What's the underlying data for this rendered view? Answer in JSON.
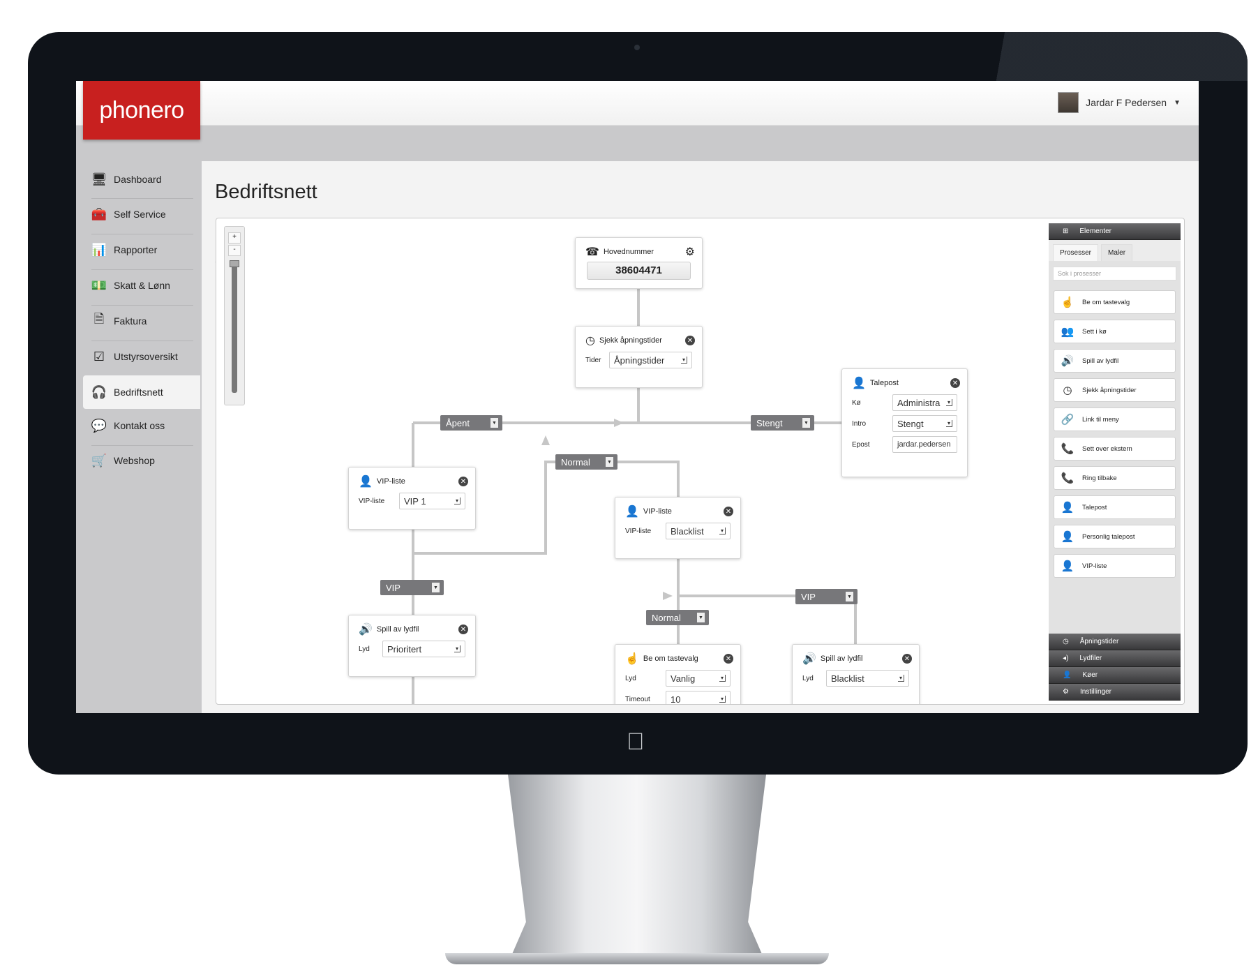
{
  "app": {
    "logo": "phonero",
    "user_name": "Jardar F Pedersen",
    "brand_color": "#c8201f"
  },
  "sidebar": {
    "items": [
      {
        "label": "Dashboard",
        "icon": "monitor-icon"
      },
      {
        "label": "Self Service",
        "icon": "toolbox-icon"
      },
      {
        "label": "Rapporter",
        "icon": "report-icon"
      },
      {
        "label": "Skatt & Lønn",
        "icon": "money-icon"
      },
      {
        "label": "Faktura",
        "icon": "document-icon"
      },
      {
        "label": "Utstyrsoversikt",
        "icon": "checklist-icon"
      },
      {
        "label": "Bedriftsnett",
        "icon": "headset-icon",
        "active": true
      },
      {
        "label": "Kontakt oss",
        "icon": "chat-icon"
      },
      {
        "label": "Webshop",
        "icon": "cart-icon"
      }
    ]
  },
  "page": {
    "title": "Bedriftsnett"
  },
  "zoom": {
    "plus": "+",
    "minus": "-"
  },
  "flow": {
    "hoved": {
      "title": "Hovednummer",
      "number": "38604471"
    },
    "sjekk": {
      "title": "Sjekk åpningstider",
      "label": "Tider",
      "value": "Åpningstider"
    },
    "talepost": {
      "title": "Talepost",
      "ko_label": "Kø",
      "ko": "Administra",
      "intro_label": "Intro",
      "intro": "Stengt",
      "epost_label": "Epost",
      "epost": "jardar.pedersen"
    },
    "tags": {
      "apent": "Åpent",
      "stengt": "Stengt",
      "normal1": "Normal",
      "vip1": "VIP",
      "normal2": "Normal",
      "vip2": "VIP"
    },
    "vip1": {
      "title": "VIP-liste",
      "label": "VIP-liste",
      "value": "VIP 1"
    },
    "vip2": {
      "title": "VIP-liste",
      "label": "VIP-liste",
      "value": "Blacklist"
    },
    "spill1": {
      "title": "Spill av lydfil",
      "label": "Lyd",
      "value": "Prioritert"
    },
    "tastevalg": {
      "title": "Be om tastevalg",
      "label": "Lyd",
      "value": "Vanlig",
      "label2": "Timeout",
      "value2": "10"
    },
    "spill2": {
      "title": "Spill av lydfil",
      "label": "Lyd",
      "value": "Blacklist"
    }
  },
  "panel": {
    "header": "Elementer",
    "tabs": [
      "Prosesser",
      "Maler"
    ],
    "search_placeholder": "Sok i prosesser",
    "items": [
      {
        "label": "Be om tastevalg",
        "icon": "keypad-icon"
      },
      {
        "label": "Sett i kø",
        "icon": "queue-icon"
      },
      {
        "label": "Spill av lydfil",
        "icon": "speaker-icon"
      },
      {
        "label": "Sjekk åpningstider",
        "icon": "clock-icon"
      },
      {
        "label": "Link til meny",
        "icon": "link-icon"
      },
      {
        "label": "Sett over ekstern",
        "icon": "transfer-icon"
      },
      {
        "label": "Ring tilbake",
        "icon": "callback-icon"
      },
      {
        "label": "Talepost",
        "icon": "user-icon"
      },
      {
        "label": "Personlig talepost",
        "icon": "user-icon"
      },
      {
        "label": "VIP-liste",
        "icon": "user-icon"
      }
    ],
    "footer": [
      {
        "label": "Åpningstider",
        "icon": "clock-icon"
      },
      {
        "label": "Lydfiler",
        "icon": "speaker-icon"
      },
      {
        "label": "Køer",
        "icon": "user-icon"
      },
      {
        "label": "Instillinger",
        "icon": "gear-icon"
      }
    ]
  }
}
